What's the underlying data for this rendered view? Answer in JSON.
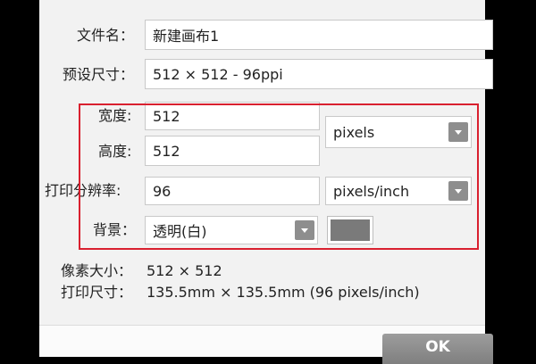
{
  "dialog": {
    "filename": {
      "label": "文件名：",
      "value": "新建画布1"
    },
    "preset": {
      "label": "预设尺寸：",
      "value": "512 × 512 - 96ppi"
    },
    "width": {
      "label": "宽度:",
      "value": "512"
    },
    "height": {
      "label": "高度:",
      "value": "512"
    },
    "size_unit": {
      "selected": "pixels"
    },
    "resolution": {
      "label": "打印分辨率:",
      "value": "96"
    },
    "resolution_unit": {
      "selected": "pixels/inch"
    },
    "background": {
      "label": "背景：",
      "selected": "透明(白)",
      "swatch_color": "#7a7a7a"
    },
    "pixel_size": {
      "label": "像素大小：",
      "value": "512 × 512"
    },
    "print_size": {
      "label": "打印尺寸：",
      "value": "135.5mm × 135.5mm (96 pixels/inch)"
    },
    "ok_label": "OK"
  },
  "colors": {
    "highlight": "#d9202f",
    "button_gray": "#8e8e8e",
    "dialog_bg": "#f2f2f2"
  }
}
